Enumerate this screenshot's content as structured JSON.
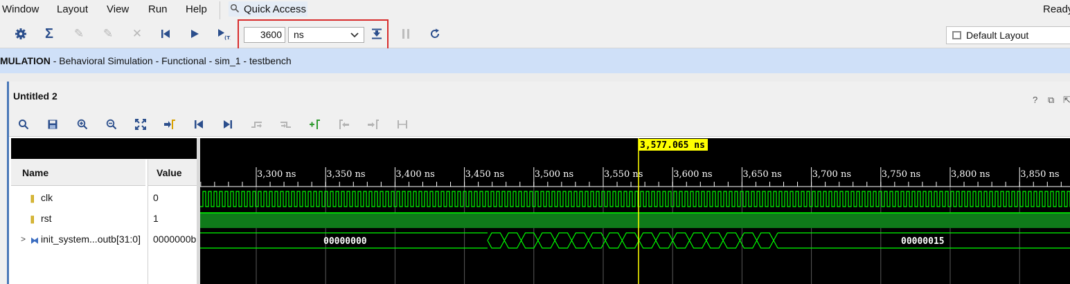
{
  "menu": {
    "items": [
      {
        "label": "Window",
        "underline": "W"
      },
      {
        "label": "Layout",
        "underline": "L"
      },
      {
        "label": "View",
        "underline": "V"
      },
      {
        "label": "Run",
        "underline": "R"
      },
      {
        "label": "Help",
        "underline": "H"
      }
    ],
    "quick_access": "Quick Access",
    "status": "Ready"
  },
  "toolbar": {
    "buttons": [
      {
        "name": "settings-icon",
        "glyph": "⚙",
        "enabled": true
      },
      {
        "name": "sigma-icon",
        "glyph": "Σ",
        "enabled": true
      },
      {
        "name": "disabled-tool-1-icon",
        "glyph": "✎",
        "enabled": false
      },
      {
        "name": "disabled-tool-2-icon",
        "glyph": "✎",
        "enabled": false
      },
      {
        "name": "disabled-tool-3-icon",
        "glyph": "✗",
        "enabled": false
      },
      {
        "name": "restart-icon",
        "glyph": "⏮",
        "enabled": true
      },
      {
        "name": "run-all-icon",
        "glyph": "▶",
        "enabled": true
      },
      {
        "name": "run-for-icon",
        "glyph": "▶",
        "enabled": true
      }
    ],
    "run_time_value": "3600",
    "run_time_unit": "ns",
    "layout_value": "Default Layout"
  },
  "banner": {
    "bold": "MULATION",
    "rest": " - Behavioral Simulation - Functional - sim_1 - testbench"
  },
  "wave_window": {
    "title": "Untitled 2",
    "title_controls": [
      "?",
      "⧉",
      "⇱"
    ],
    "name_header": "Name",
    "value_header": "Value",
    "signals": [
      {
        "name": "clk",
        "value": "0",
        "type": "bit"
      },
      {
        "name": "rst",
        "value": "1",
        "type": "bit"
      },
      {
        "name": "init_system...outb[31:0]",
        "value": "0000000b",
        "type": "bus"
      }
    ],
    "cursor_time": "3,577.065 ns",
    "ticks": [
      "3,300 ns",
      "3,350 ns",
      "3,400 ns",
      "3,450 ns",
      "3,500 ns",
      "3,550 ns",
      "3,600 ns",
      "3,650 ns",
      "3,700 ns",
      "3,750 ns",
      "3,800 ns",
      "3,850 ns"
    ],
    "bus_values": {
      "left": "00000000",
      "right": "00000015"
    },
    "colors": {
      "wave": "#00ff00",
      "wave_fill": "#0f7a1a",
      "cursor": "#ffff00",
      "background": "#000000"
    }
  }
}
